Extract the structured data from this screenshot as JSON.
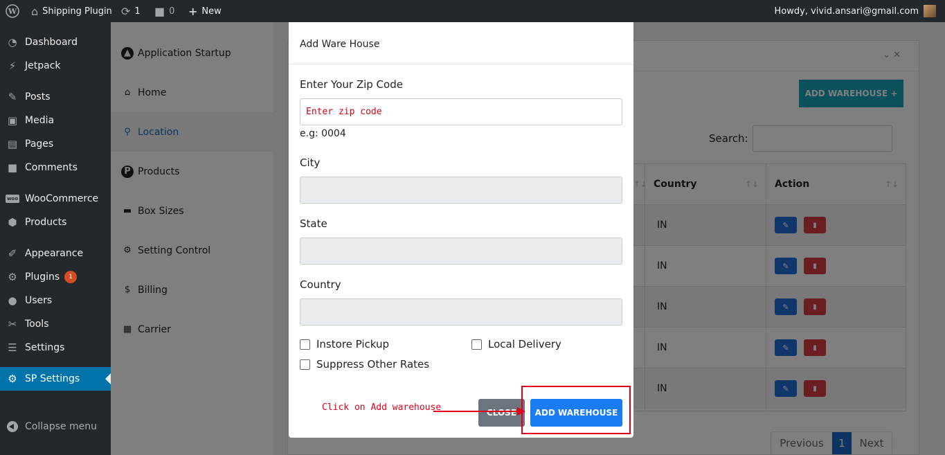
{
  "adminbar": {
    "site_name": "Shipping Plugin",
    "updates_count": "1",
    "comments_count": "0",
    "new_label": "New",
    "howdy": "Howdy, vivid.ansari@gmail.com"
  },
  "adminmenu": {
    "items": [
      {
        "label": "Dashboard"
      },
      {
        "label": "Jetpack"
      },
      {
        "label": "Posts"
      },
      {
        "label": "Media"
      },
      {
        "label": "Pages"
      },
      {
        "label": "Comments"
      },
      {
        "label": "WooCommerce"
      },
      {
        "label": "Products"
      },
      {
        "label": "Appearance"
      },
      {
        "label": "Plugins",
        "badge": "1"
      },
      {
        "label": "Users"
      },
      {
        "label": "Tools"
      },
      {
        "label": "Settings"
      },
      {
        "label": "SP Settings"
      }
    ],
    "collapse_label": "Collapse menu"
  },
  "plugin_nav": {
    "items": [
      {
        "label": "Application Startup"
      },
      {
        "label": "Home"
      },
      {
        "label": "Location"
      },
      {
        "label": "Products",
        "glyph": "P"
      },
      {
        "label": "Box Sizes"
      },
      {
        "label": "Setting Control"
      },
      {
        "label": "Billing"
      },
      {
        "label": "Carrier"
      }
    ]
  },
  "main": {
    "add_warehouse_button": "ADD WAREHOUSE +",
    "search_label": "Search:",
    "table": {
      "headers": [
        "Country",
        "Action"
      ],
      "rows": [
        {
          "country": "IN"
        },
        {
          "country": "IN"
        },
        {
          "country": "IN"
        },
        {
          "country": "IN"
        },
        {
          "country": "IN"
        }
      ]
    },
    "pagination": {
      "previous": "Previous",
      "current": "1",
      "next": "Next"
    }
  },
  "modal": {
    "title": "Add Ware House",
    "zip_label": "Enter Your Zip Code",
    "zip_placeholder": "Enter zip code",
    "zip_hint": "e.g: 0004",
    "city_label": "City",
    "state_label": "State",
    "country_label": "Country",
    "checkbox_instore": "Instore Pickup",
    "checkbox_local": "Local Delivery",
    "checkbox_suppress": "Suppress Other Rates",
    "close_button": "CLOSE",
    "add_button": "ADD WAREHOUSE"
  },
  "annotation": {
    "text": "Click on Add warehouse",
    "color": "#e0001b"
  },
  "colors": {
    "admin_dark": "#23282d",
    "admin_accent": "#0073aa",
    "primary_button": "#1a7cf5",
    "teal_button": "#17a2b8",
    "delete_button": "#d63a44"
  }
}
